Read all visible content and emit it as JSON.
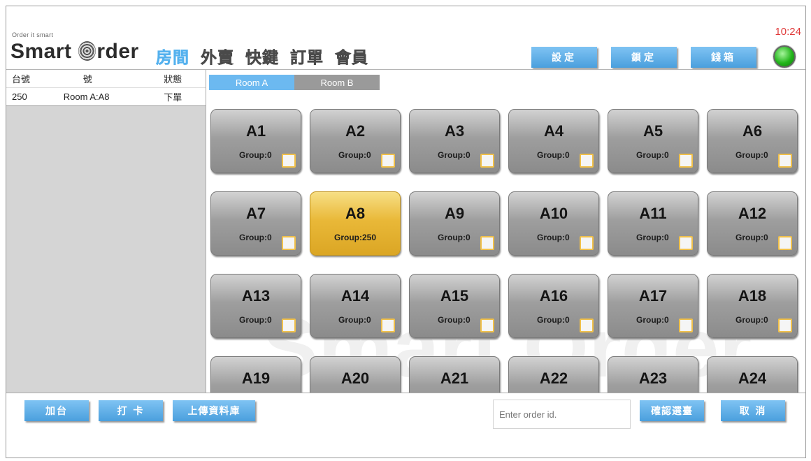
{
  "header": {
    "tagline": "Order it smart",
    "logo_text_1": "Smart ",
    "logo_text_2": "rder",
    "clock": "10:24",
    "nav": [
      {
        "label": "房間",
        "active": true
      },
      {
        "label": "外賣",
        "active": false
      },
      {
        "label": "快鍵",
        "active": false
      },
      {
        "label": "訂單",
        "active": false
      },
      {
        "label": "會員",
        "active": false
      }
    ],
    "buttons": {
      "settings": "設定",
      "lock": "鎖定",
      "cashbox": "錢箱"
    }
  },
  "left_panel": {
    "headers": {
      "table_no": "台號",
      "number": "號",
      "status": "狀態"
    },
    "rows": [
      {
        "table_no": "250",
        "number": "Room A:A8",
        "status": "下單"
      }
    ]
  },
  "tabs": [
    {
      "label": "Room A",
      "active": true
    },
    {
      "label": "Room B",
      "active": false
    }
  ],
  "rooms": [
    {
      "name": "A1",
      "group": "Group:0"
    },
    {
      "name": "A2",
      "group": "Group:0"
    },
    {
      "name": "A3",
      "group": "Group:0"
    },
    {
      "name": "A4",
      "group": "Group:0"
    },
    {
      "name": "A5",
      "group": "Group:0"
    },
    {
      "name": "A6",
      "group": "Group:0"
    },
    {
      "name": "A7",
      "group": "Group:0"
    },
    {
      "name": "A8",
      "group": "Group:250"
    },
    {
      "name": "A9",
      "group": "Group:0"
    },
    {
      "name": "A10",
      "group": "Group:0"
    },
    {
      "name": "A11",
      "group": "Group:0"
    },
    {
      "name": "A12",
      "group": "Group:0"
    },
    {
      "name": "A13",
      "group": "Group:0"
    },
    {
      "name": "A14",
      "group": "Group:0"
    },
    {
      "name": "A15",
      "group": "Group:0"
    },
    {
      "name": "A16",
      "group": "Group:0"
    },
    {
      "name": "A17",
      "group": "Group:0"
    },
    {
      "name": "A18",
      "group": "Group:0"
    },
    {
      "name": "A19",
      "group": ""
    },
    {
      "name": "A20",
      "group": ""
    },
    {
      "name": "A21",
      "group": ""
    },
    {
      "name": "A22",
      "group": ""
    },
    {
      "name": "A23",
      "group": ""
    },
    {
      "name": "A24",
      "group": ""
    }
  ],
  "selected_room": "A8",
  "watermark": "Smart Order",
  "bottom": {
    "add_table": "加台",
    "clock_in": "打 卡",
    "upload_db": "上傳資料庫",
    "order_placeholder": "Enter order id.",
    "confirm_table": "確認選臺",
    "cancel": "取 消"
  },
  "colors": {
    "accent": "#54b1ee",
    "selected_room": "#e9b838",
    "clock": "#e03a3a",
    "status_light": "#22b51a"
  }
}
